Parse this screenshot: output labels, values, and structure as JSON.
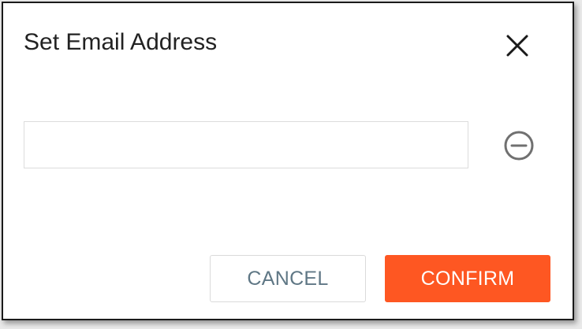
{
  "dialog": {
    "title": "Set Email Address",
    "close_icon": "close-icon"
  },
  "email": {
    "value": "",
    "placeholder": "",
    "remove_icon": "minus-circle-icon"
  },
  "actions": {
    "cancel_label": "CANCEL",
    "confirm_label": "CONFIRM"
  },
  "colors": {
    "accent": "#fe5722",
    "cancel_text": "#5f7785",
    "title_text": "#222222",
    "icon_gray": "#707070"
  }
}
